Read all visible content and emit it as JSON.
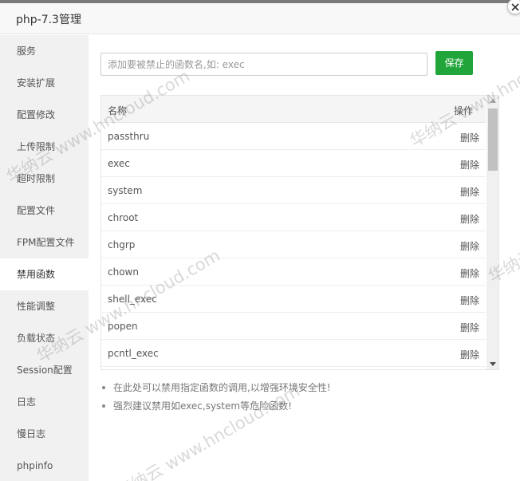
{
  "window": {
    "title": "php-7.3管理"
  },
  "sidebar": {
    "items": [
      {
        "label": "服务"
      },
      {
        "label": "安装扩展"
      },
      {
        "label": "配置修改"
      },
      {
        "label": "上传限制"
      },
      {
        "label": "超时限制"
      },
      {
        "label": "配置文件"
      },
      {
        "label": "FPM配置文件"
      },
      {
        "label": "禁用函数",
        "active": true
      },
      {
        "label": "性能调整"
      },
      {
        "label": "负载状态"
      },
      {
        "label": "Session配置"
      },
      {
        "label": "日志"
      },
      {
        "label": "慢日志"
      },
      {
        "label": "phpinfo"
      }
    ]
  },
  "form": {
    "input_placeholder": "添加要被禁止的函数名,如: exec",
    "input_value": "",
    "save_label": "保存"
  },
  "table": {
    "headers": {
      "name": "名称",
      "action": "操作"
    },
    "rows": [
      {
        "name": "passthru",
        "action": "删除"
      },
      {
        "name": "exec",
        "action": "删除"
      },
      {
        "name": "system",
        "action": "删除"
      },
      {
        "name": "chroot",
        "action": "删除"
      },
      {
        "name": "chgrp",
        "action": "删除"
      },
      {
        "name": "chown",
        "action": "删除"
      },
      {
        "name": "shell_exec",
        "action": "删除"
      },
      {
        "name": "popen",
        "action": "删除"
      },
      {
        "name": "pcntl_exec",
        "action": "删除"
      }
    ]
  },
  "tips": [
    "在此处可以禁用指定函数的调用,以增强环境安全性!",
    "强烈建议禁用如exec,system等危险函数!"
  ],
  "watermark": {
    "text": "华纳云 www.hncloud.com"
  },
  "colors": {
    "accent_green": "#20a53a",
    "sidebar_bg": "#f1f1f1"
  },
  "icons": {
    "close": "close-icon"
  }
}
